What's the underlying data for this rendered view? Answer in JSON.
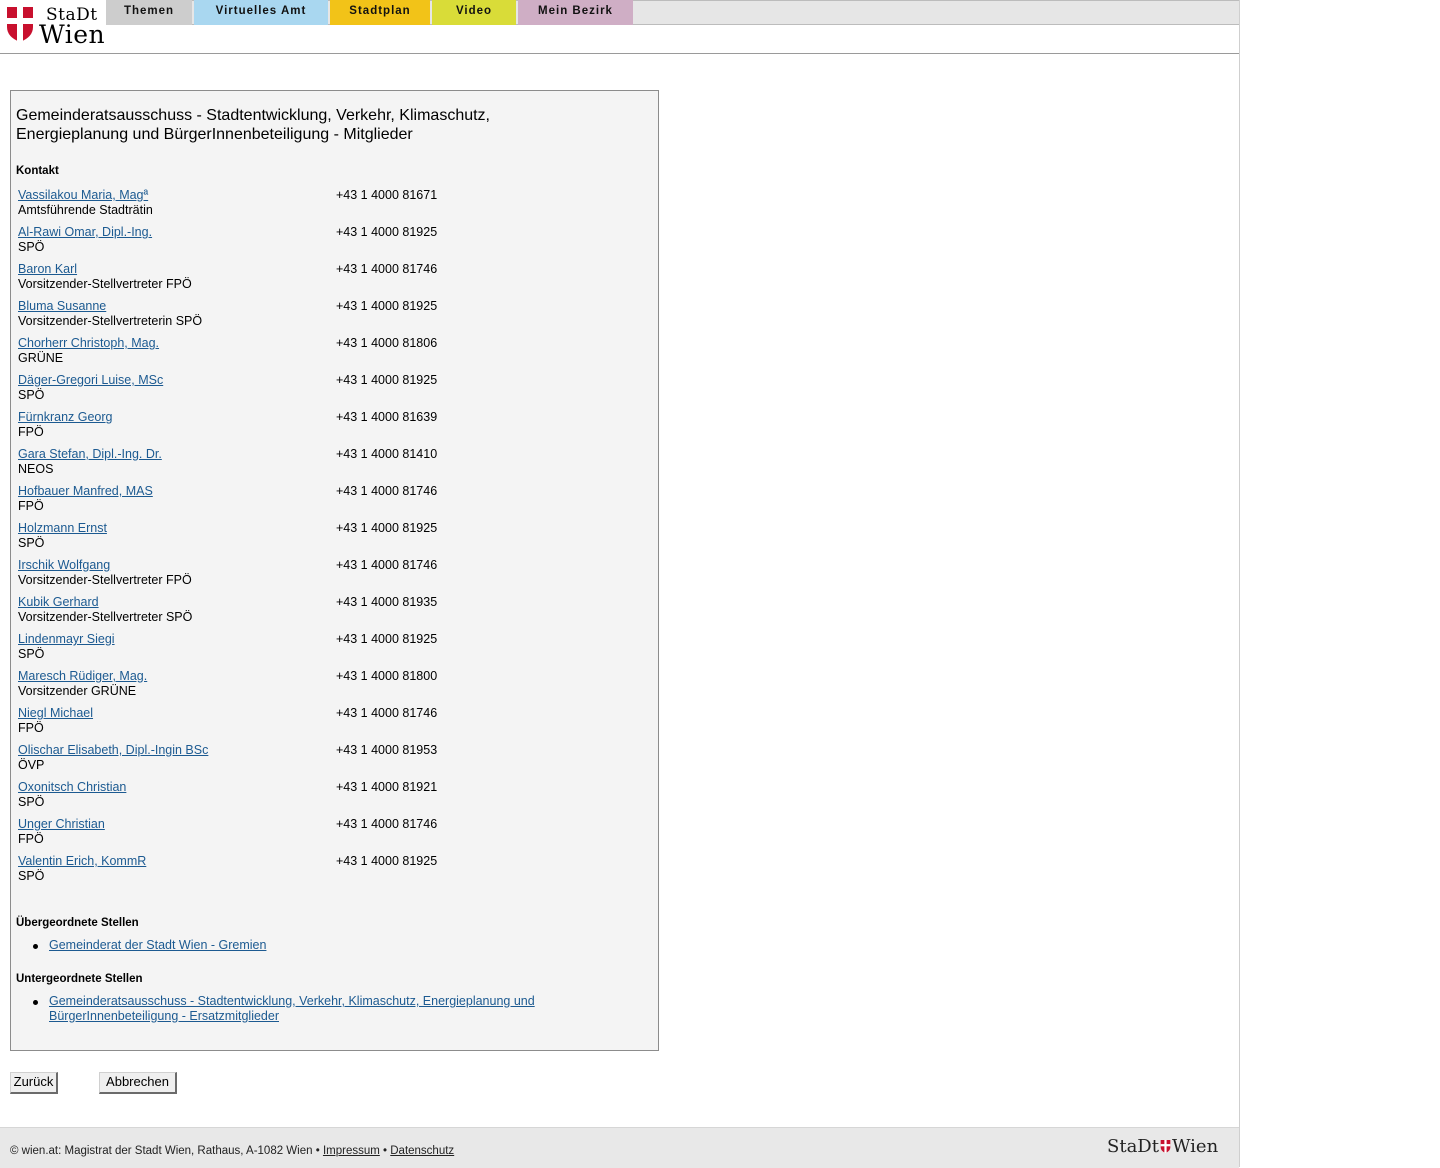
{
  "header": {
    "logo": {
      "line1": "StaDt",
      "line2": "Wien"
    },
    "tabs": [
      {
        "label": "Themen",
        "color": "#cdcdcd"
      },
      {
        "label": "Virtuelles Amt",
        "color": "#a9d7f0"
      },
      {
        "label": "Stadtplan",
        "color": "#f2c318"
      },
      {
        "label": "Video",
        "color": "#d9dc38"
      },
      {
        "label": "Mein Bezirk",
        "color": "#cfaec5"
      }
    ]
  },
  "main": {
    "title": "Gemeinderatsausschuss - Stadtentwicklung, Verkehr, Klimaschutz, Energieplanung und BürgerInnenbeteiligung - Mitglieder",
    "contacts_heading": "Kontakt",
    "contacts": [
      {
        "name": "Vassilakou Maria, Magª",
        "role": "Amtsführende Stadträtin",
        "phone": "+43 1 4000 81671"
      },
      {
        "name": "Al-Rawi Omar, Dipl.-Ing.",
        "role": "SPÖ",
        "phone": "+43 1 4000 81925"
      },
      {
        "name": "Baron Karl",
        "role": "Vorsitzender-Stellvertreter FPÖ",
        "phone": "+43 1 4000 81746"
      },
      {
        "name": "Bluma Susanne",
        "role": "Vorsitzender-Stellvertreterin SPÖ",
        "phone": "+43 1 4000 81925"
      },
      {
        "name": "Chorherr Christoph, Mag.",
        "role": "GRÜNE",
        "phone": "+43 1 4000 81806"
      },
      {
        "name": "Däger-Gregori Luise, MSc",
        "role": "SPÖ",
        "phone": "+43 1 4000 81925"
      },
      {
        "name": "Fürnkranz Georg",
        "role": "FPÖ",
        "phone": "+43 1 4000 81639"
      },
      {
        "name": "Gara Stefan, Dipl.-Ing. Dr.",
        "role": "NEOS",
        "phone": "+43 1 4000 81410"
      },
      {
        "name": "Hofbauer Manfred, MAS",
        "role": "FPÖ",
        "phone": "+43 1 4000 81746"
      },
      {
        "name": "Holzmann Ernst",
        "role": "SPÖ",
        "phone": "+43 1 4000 81925"
      },
      {
        "name": "Irschik Wolfgang",
        "role": "Vorsitzender-Stellvertreter FPÖ",
        "phone": "+43 1 4000 81746"
      },
      {
        "name": "Kubik Gerhard",
        "role": "Vorsitzender-Stellvertreter SPÖ",
        "phone": "+43 1 4000 81935"
      },
      {
        "name": "Lindenmayr Siegi",
        "role": "SPÖ",
        "phone": "+43 1 4000 81925"
      },
      {
        "name": "Maresch Rüdiger, Mag.",
        "role": "Vorsitzender GRÜNE",
        "phone": "+43 1 4000 81800"
      },
      {
        "name": "Niegl Michael",
        "role": "FPÖ",
        "phone": "+43 1 4000 81746"
      },
      {
        "name": "Olischar Elisabeth, Dipl.-Ingin BSc",
        "role": "ÖVP",
        "phone": "+43 1 4000 81953"
      },
      {
        "name": "Oxonitsch Christian",
        "role": "SPÖ",
        "phone": "+43 1 4000 81921"
      },
      {
        "name": "Unger Christian",
        "role": "FPÖ",
        "phone": "+43 1 4000 81746"
      },
      {
        "name": "Valentin Erich, KommR",
        "role": "SPÖ",
        "phone": "+43 1 4000 81925"
      }
    ],
    "parent_heading": "Übergeordnete Stellen",
    "parent_links": [
      "Gemeinderat der Stadt Wien - Gremien"
    ],
    "child_heading": "Untergeordnete Stellen",
    "child_links": [
      "Gemeinderatsausschuss - Stadtentwicklung, Verkehr, Klimaschutz, Energieplanung und BürgerInnenbeteiligung - Ersatzmitglieder"
    ]
  },
  "buttons": {
    "back": "Zurück",
    "cancel": "Abbrechen"
  },
  "footer": {
    "text": "© wien.at: Magistrat der Stadt Wien, Rathaus, A-1082 Wien •",
    "impressum": "Impressum",
    "separator": "•",
    "datenschutz": "Datenschutz",
    "logo_left": "StaDt",
    "logo_right": "Wien"
  },
  "colors": {
    "link": "#1c5a91",
    "wien_red": "#c8102e"
  }
}
